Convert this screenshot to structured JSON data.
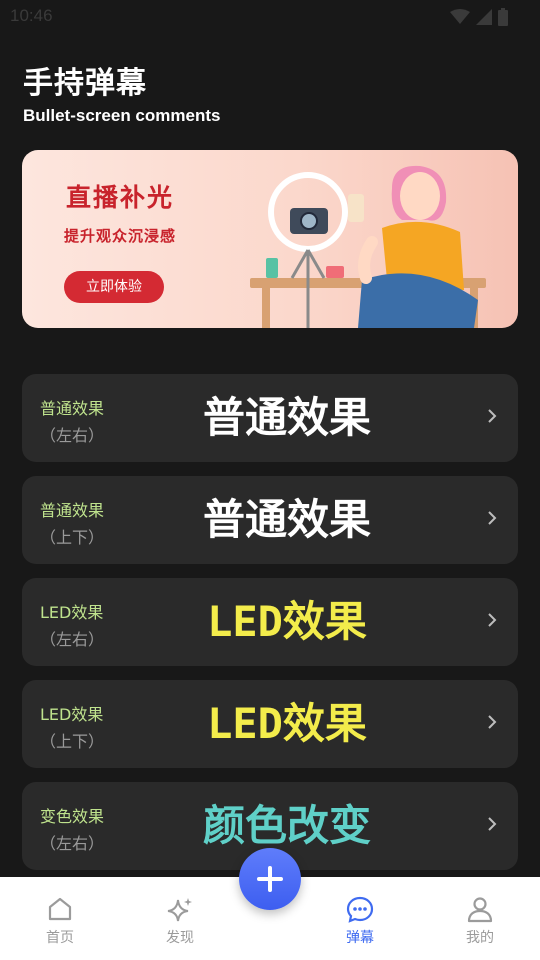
{
  "status": {
    "time": "10:46"
  },
  "header": {
    "title": "手持弹幕",
    "subtitle": "Bullet-screen comments"
  },
  "banner": {
    "title": "直播补光",
    "subtitle": "提升观众沉浸感",
    "button": "立即体验"
  },
  "cards": [
    {
      "label": "普通效果",
      "sub": "（左右）",
      "preview": "普通效果",
      "color": "#ffffff"
    },
    {
      "label": "普通效果",
      "sub": "（上下）",
      "preview": "普通效果",
      "color": "#ffffff"
    },
    {
      "label": "LED效果",
      "sub": "（左右）",
      "preview": "LED效果",
      "color": "#f3ec4b"
    },
    {
      "label": "LED效果",
      "sub": "（上下）",
      "preview": "LED效果",
      "color": "#f3ec4b"
    },
    {
      "label": "变色效果",
      "sub": "（左右）",
      "preview": "颜色改变",
      "color": "#5fd0c8"
    }
  ],
  "tabbar": {
    "tabs": [
      {
        "label": "首页",
        "icon": "home-icon"
      },
      {
        "label": "发现",
        "icon": "sparkle-icon"
      },
      {
        "label": "弹幕",
        "icon": "chat-bubble-icon",
        "active": true
      },
      {
        "label": "我的",
        "icon": "user-icon"
      }
    ],
    "fab_icon": "plus-icon",
    "accent": "#3f6bf0"
  }
}
